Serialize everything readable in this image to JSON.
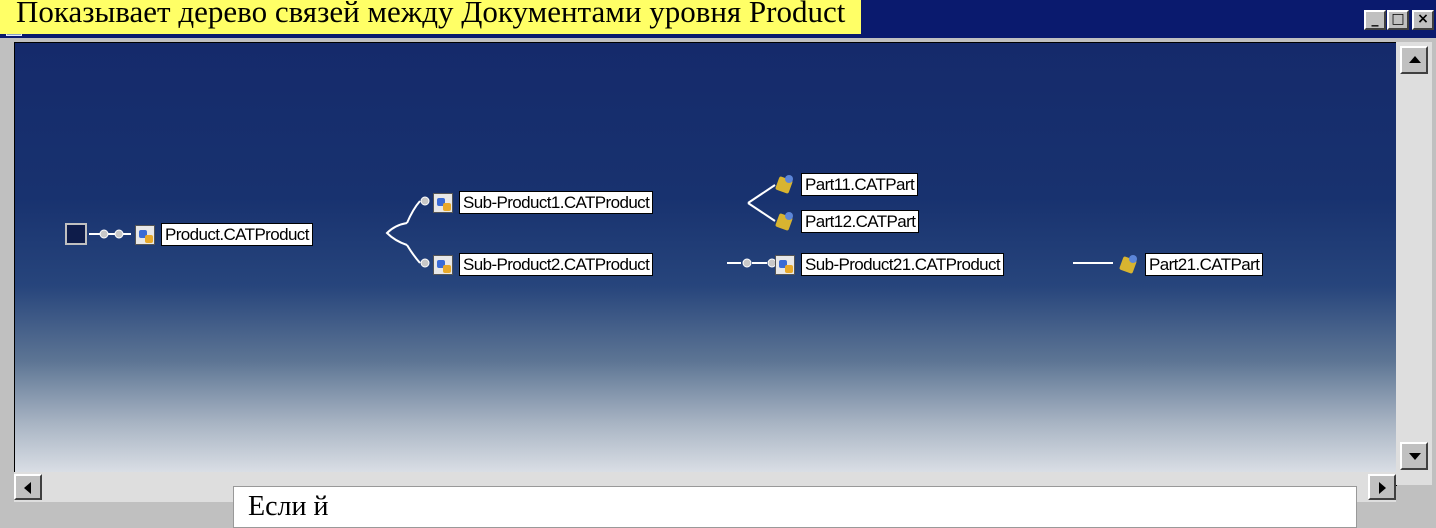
{
  "caption": "Показывает дерево связей между Документами уровня Product",
  "window": {
    "buttons": {
      "minimize": "_",
      "maximize": "□",
      "close": "×"
    }
  },
  "tree": {
    "root": "Product.CATProduct",
    "sub1": "Sub-Product1.CATProduct",
    "sub2": "Sub-Product2.CATProduct",
    "part11": "Part11.CATPart",
    "part12": "Part12.CATPart",
    "sub21": "Sub-Product21.CATProduct",
    "part21": "Part21.CATPart"
  },
  "footer_text": "Если й",
  "icons": {
    "root": "app-root-icon",
    "product": "product-icon",
    "part": "part-icon"
  }
}
